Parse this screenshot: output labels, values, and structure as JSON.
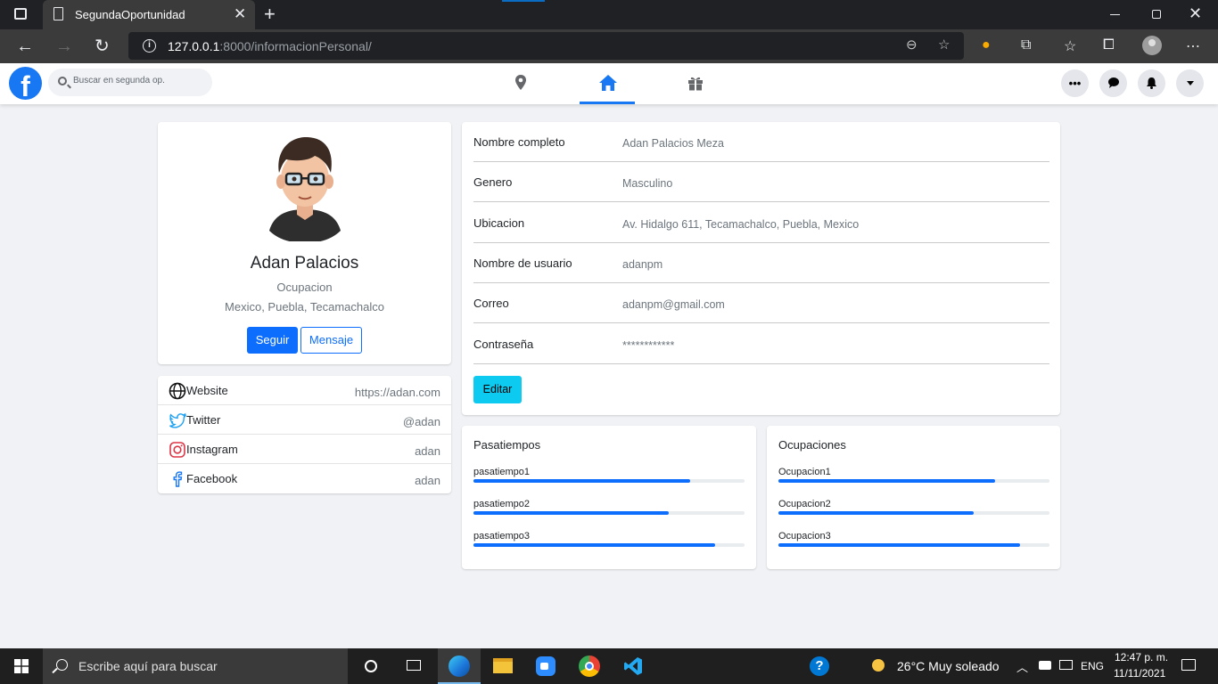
{
  "browser": {
    "tab_title": "SegundaOportunidad",
    "url_host": "127.0.0.1",
    "url_rest": ":8000/informacionPersonal/"
  },
  "navbar": {
    "search_placeholder": "Buscar en segunda op."
  },
  "profile": {
    "name": "Adan Palacios",
    "occupation": "Ocupacion",
    "location": "Mexico, Puebla, Tecamachalco",
    "follow_label": "Seguir",
    "message_label": "Mensaje"
  },
  "social": [
    {
      "name": "Website",
      "value": "https://adan.com",
      "icon": "globe-icon"
    },
    {
      "name": "Twitter",
      "value": "@adan",
      "icon": "twitter-icon"
    },
    {
      "name": "Instagram",
      "value": "adan",
      "icon": "instagram-icon"
    },
    {
      "name": "Facebook",
      "value": "adan",
      "icon": "facebook-icon"
    }
  ],
  "info": [
    {
      "label": "Nombre completo",
      "value": "Adan Palacios Meza"
    },
    {
      "label": "Genero",
      "value": "Masculino"
    },
    {
      "label": "Ubicacion",
      "value": "Av. Hidalgo 611, Tecamachalco, Puebla, Mexico"
    },
    {
      "label": "Nombre de usuario",
      "value": "adanpm"
    },
    {
      "label": "Correo",
      "value": "adanpm@gmail.com"
    },
    {
      "label": "Contraseña",
      "value": "************"
    }
  ],
  "edit_label": "Editar",
  "hobbies": {
    "title": "Pasatiempos",
    "items": [
      {
        "label": "pasatiempo1",
        "percent": 80
      },
      {
        "label": "pasatiempo2",
        "percent": 72
      },
      {
        "label": "pasatiempo3",
        "percent": 89
      }
    ]
  },
  "occupations": {
    "title": "Ocupaciones",
    "items": [
      {
        "label": "Ocupacion1",
        "percent": 80
      },
      {
        "label": "Ocupacion2",
        "percent": 72
      },
      {
        "label": "Ocupacion3",
        "percent": 89
      }
    ]
  },
  "colors": {
    "primary": "#0d6efd",
    "info": "#0dcaf0",
    "brand": "#1877f2",
    "background": "#f0f2f5"
  },
  "taskbar": {
    "search_placeholder": "Escribe aquí para buscar",
    "weather": "26°C  Muy soleado",
    "lang": "ENG",
    "time": "12:47 p. m.",
    "date": "11/11/2021"
  }
}
